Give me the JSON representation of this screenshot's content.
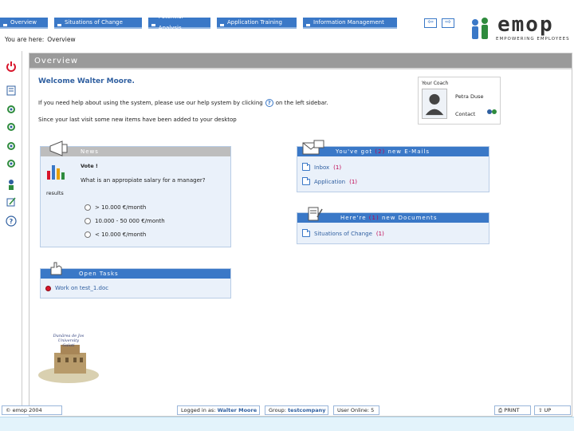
{
  "tabs": [
    {
      "label": "Overview"
    },
    {
      "label": "Situations of Change"
    },
    {
      "label": "Potential Analysis"
    },
    {
      "label": "Application Training"
    },
    {
      "label": "Information Management"
    }
  ],
  "logo": {
    "word": "emop",
    "tagline": "EMPOWERING EMPLOYEES"
  },
  "breadcrumb": {
    "prefix": "You are here:",
    "current": "Overview"
  },
  "main": {
    "header": "Overview",
    "welcome": "Welcome Walter Moore.",
    "help_line_before": "If you need help about using the system, please use our help system by clicking",
    "help_line_after": "on the left sidebar.",
    "desktop_line": "Since your last visit some new items have been added to your desktop"
  },
  "coach": {
    "title": "Your Coach",
    "name": "Petra Duse",
    "contact": "Contact"
  },
  "news": {
    "title": "News",
    "vote_label": "Vote !",
    "question": "What is an appropiate salary for a manager?",
    "results": "results",
    "options": [
      "> 10.000 €/month",
      "10.000 - 50 000 €/month",
      "< 10.000 €/month"
    ]
  },
  "mail": {
    "title_before": "You've got",
    "count": "(2)",
    "title_after": "new E-Mails",
    "items": [
      {
        "label": "Inbox",
        "count": "(1)"
      },
      {
        "label": "Application",
        "count": "(1)"
      }
    ]
  },
  "documents": {
    "title_before": "Here're",
    "count": "(1)",
    "title_after": "new Documents",
    "items": [
      {
        "label": "Situations of Change",
        "count": "(1)"
      }
    ]
  },
  "tasks": {
    "title": "Open Tasks",
    "items": [
      {
        "label": "Work on test_1.doc"
      }
    ]
  },
  "university": {
    "name": "Dunărea de Jos University Galati"
  },
  "footer": {
    "copyright": "© emop 2004",
    "logged_label": "Logged in as:",
    "logged_user": "Walter Moore",
    "group_label": "Group:",
    "group_value": "testcompany",
    "users_online": "User Online: 5",
    "print": "PRINT",
    "up": "UP"
  },
  "colors": {
    "accent": "#3a78c7",
    "highlight": "#c0004e",
    "header_grey": "#9a9a9a"
  }
}
